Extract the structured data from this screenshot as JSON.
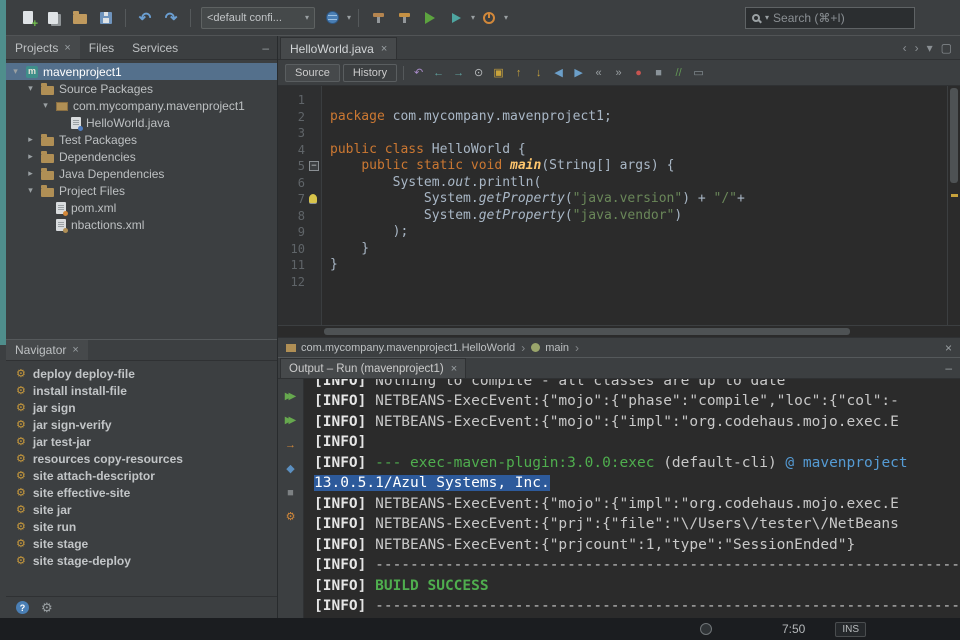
{
  "toolbar": {
    "config_value": "<default confi...",
    "search_placeholder": "Search (⌘+I)"
  },
  "glyphs": {
    "undo": "↶",
    "redo": "↷",
    "dropdown": "▾",
    "close": "×",
    "chev_left": "‹",
    "chev_right": "›",
    "minimize": "–",
    "maximize": "▢",
    "breadcrumb_sep": "›",
    "help": "?",
    "gear": "⚙"
  },
  "left_panel": {
    "tabs": [
      {
        "label": "Projects"
      },
      {
        "label": "Files"
      },
      {
        "label": "Services"
      }
    ]
  },
  "project_tree": {
    "rows": [
      {
        "label": "mavenproject1",
        "depth": 0,
        "expand": "open",
        "icon": "maven-project",
        "selected": true
      },
      {
        "label": "Source Packages",
        "depth": 1,
        "expand": "open",
        "icon": "package-folder"
      },
      {
        "label": "com.mycompany.mavenproject1",
        "depth": 2,
        "expand": "open",
        "icon": "package"
      },
      {
        "label": "HelloWorld.java",
        "depth": 3,
        "expand": "none",
        "icon": "java-file"
      },
      {
        "label": "Test Packages",
        "depth": 1,
        "expand": "closed",
        "icon": "package-folder"
      },
      {
        "label": "Dependencies",
        "depth": 1,
        "expand": "closed",
        "icon": "libs-folder"
      },
      {
        "label": "Java Dependencies",
        "depth": 1,
        "expand": "closed",
        "icon": "libs-folder"
      },
      {
        "label": "Project Files",
        "depth": 1,
        "expand": "open",
        "icon": "files-folder"
      },
      {
        "label": "pom.xml",
        "depth": 2,
        "expand": "none",
        "icon": "pom-file"
      },
      {
        "label": "nbactions.xml",
        "depth": 2,
        "expand": "none",
        "icon": "xml-file"
      }
    ]
  },
  "navigator": {
    "tab_label": "Navigator",
    "items": [
      "deploy deploy-file",
      "install install-file",
      "jar sign",
      "jar sign-verify",
      "jar test-jar",
      "resources copy-resources",
      "site attach-descriptor",
      "site effective-site",
      "site jar",
      "site run",
      "site stage",
      "site stage-deploy"
    ]
  },
  "editor": {
    "tab_label": "HelloWorld.java",
    "source_btn": "Source",
    "history_btn": "History",
    "toolbar_icons": [
      {
        "name": "last-edit-location-icon",
        "glyph": "↶",
        "color": "#a98cc9"
      },
      {
        "name": "back-icon",
        "glyph": "←",
        "color": "#5fa3a0"
      },
      {
        "name": "forward-icon",
        "glyph": "→",
        "color": "#5fa3a0"
      },
      {
        "name": "find-selection-icon",
        "glyph": "⊙",
        "color": "#b9bcbe"
      },
      {
        "name": "toggle-highlight-icon",
        "glyph": "▣",
        "color": "#c7a23c"
      },
      {
        "name": "previous-occurrence-icon",
        "glyph": "↑",
        "color": "#c7a23c"
      },
      {
        "name": "next-occurrence-icon",
        "glyph": "↓",
        "color": "#c7a23c"
      },
      {
        "name": "previous-bookmark-icon",
        "glyph": "◀",
        "color": "#6b9fc9"
      },
      {
        "name": "next-bookmark-icon",
        "glyph": "▶",
        "color": "#6b9fc9"
      },
      {
        "name": "shift-left-icon",
        "glyph": "«",
        "color": "#9aa0a3"
      },
      {
        "name": "shift-right-icon",
        "glyph": "»",
        "color": "#9aa0a3"
      },
      {
        "name": "toggle-breakpoint-icon",
        "glyph": "●",
        "color": "#c75450"
      },
      {
        "name": "stop-macro-icon",
        "glyph": "■",
        "color": "#8a9399"
      },
      {
        "name": "comment-icon",
        "glyph": "//",
        "color": "#629755"
      },
      {
        "name": "uncomment-icon",
        "glyph": "▭",
        "color": "#8a9399"
      }
    ],
    "code": {
      "lines": [
        [],
        [
          {
            "t": "package ",
            "y": "k"
          },
          {
            "t": "com.mycompany.mavenproject1;",
            "y": "p"
          }
        ],
        [],
        [
          {
            "t": "public class ",
            "y": "k"
          },
          {
            "t": "HelloWorld {",
            "y": "p"
          }
        ],
        [
          {
            "t": "    ",
            "y": "p"
          },
          {
            "t": "public static void ",
            "y": "k"
          },
          {
            "t": "main",
            "y": "m"
          },
          {
            "t": "(String[] args) {",
            "y": "p"
          }
        ],
        [
          {
            "t": "        System.",
            "y": "p"
          },
          {
            "t": "out",
            "y": "i"
          },
          {
            "t": ".println(",
            "y": "p"
          }
        ],
        [
          {
            "t": "            System.",
            "y": "p"
          },
          {
            "t": "getProperty",
            "y": "i"
          },
          {
            "t": "(",
            "y": "p"
          },
          {
            "t": "\"java.version\"",
            "y": "s"
          },
          {
            "t": ") + ",
            "y": "p"
          },
          {
            "t": "\"/\"",
            "y": "s"
          },
          {
            "t": "+",
            "y": "p"
          }
        ],
        [
          {
            "t": "            System.",
            "y": "p"
          },
          {
            "t": "getProperty",
            "y": "i"
          },
          {
            "t": "(",
            "y": "p"
          },
          {
            "t": "\"java.vendor\"",
            "y": "s"
          },
          {
            "t": ")",
            "y": "p"
          }
        ],
        [
          {
            "t": "        );",
            "y": "p"
          }
        ],
        [
          {
            "t": "    }",
            "y": "p"
          }
        ],
        [
          {
            "t": "}",
            "y": "p"
          }
        ],
        []
      ],
      "markers": [
        {
          "line": 5,
          "type": "fold"
        },
        {
          "line": 7,
          "type": "bulb"
        }
      ]
    },
    "breadcrumb": [
      {
        "label": "com.mycompany.mavenproject1.HelloWorld",
        "icon": "package"
      },
      {
        "label": "main",
        "icon": "method"
      }
    ]
  },
  "output": {
    "tab_label": "Output – Run (mavenproject1)",
    "actions": [
      {
        "name": "rerun-icon",
        "glyph": "▶▶",
        "color": "#66a84e",
        "dbl": true
      },
      {
        "name": "rerun-with-parameters-icon",
        "glyph": "▶▶",
        "color": "#66a84e",
        "dbl": true
      },
      {
        "name": "stop-icon",
        "glyph": "→",
        "color": "#d2883a"
      },
      {
        "name": "run-config-icon",
        "glyph": "◆",
        "color": "#5b8fc0"
      },
      {
        "name": "stop-build-icon",
        "glyph": "■",
        "color": "#7d8183"
      },
      {
        "name": "output-settings-icon",
        "glyph": "⚙",
        "color": "#d2883a"
      }
    ],
    "lines": [
      {
        "clipped": true,
        "segments": [
          {
            "t": "[INFO] ",
            "y": "n"
          },
          {
            "t": "Nothing to compile - all classes are up to date",
            "y": "o"
          }
        ]
      },
      {
        "segments": [
          {
            "t": "[INFO] ",
            "y": "n"
          },
          {
            "t": "NETBEANS-ExecEvent:{\"mojo\":{\"phase\":\"compile\",\"loc\":{\"col\":-",
            "y": "o"
          }
        ]
      },
      {
        "segments": [
          {
            "t": "[INFO] ",
            "y": "n"
          },
          {
            "t": "NETBEANS-ExecEvent:{\"mojo\":{\"impl\":\"org.codehaus.mojo.exec.E",
            "y": "o"
          }
        ]
      },
      {
        "segments": [
          {
            "t": "[INFO]",
            "y": "n"
          }
        ]
      },
      {
        "segments": [
          {
            "t": "[INFO] ",
            "y": "n"
          },
          {
            "t": "--- exec-maven-plugin:3.0.0:exec ",
            "y": "g"
          },
          {
            "t": "(default-cli) ",
            "y": "o"
          },
          {
            "t": "@ mavenproject",
            "y": "b"
          }
        ]
      },
      {
        "selected": true,
        "segments": [
          {
            "t": "13.0.5.1/Azul Systems, Inc.",
            "y": "o"
          }
        ]
      },
      {
        "segments": [
          {
            "t": "[INFO] ",
            "y": "n"
          },
          {
            "t": "NETBEANS-ExecEvent:{\"mojo\":{\"impl\":\"org.codehaus.mojo.exec.E",
            "y": "o"
          }
        ]
      },
      {
        "segments": [
          {
            "t": "[INFO] ",
            "y": "n"
          },
          {
            "t": "NETBEANS-ExecEvent:{\"prj\":{\"file\":\"\\/Users\\/tester\\/NetBeans",
            "y": "o"
          }
        ]
      },
      {
        "segments": [
          {
            "t": "[INFO] ",
            "y": "n"
          },
          {
            "t": "NETBEANS-ExecEvent:{\"prjcount\":1,\"type\":\"SessionEnded\"}",
            "y": "o"
          }
        ]
      },
      {
        "segments": [
          {
            "t": "[INFO] ",
            "y": "n"
          },
          {
            "t": "--------------------------------------------------------------------------------",
            "y": "o"
          }
        ]
      },
      {
        "segments": [
          {
            "t": "[INFO] ",
            "y": "n"
          },
          {
            "t": "BUILD SUCCESS",
            "y": "G"
          }
        ]
      },
      {
        "segments": [
          {
            "t": "[INFO] ",
            "y": "n"
          },
          {
            "t": "--------------------------------------------------------------------------------",
            "y": "o"
          }
        ]
      }
    ]
  },
  "statusbar": {
    "time": "7:50",
    "mode": "INS"
  }
}
